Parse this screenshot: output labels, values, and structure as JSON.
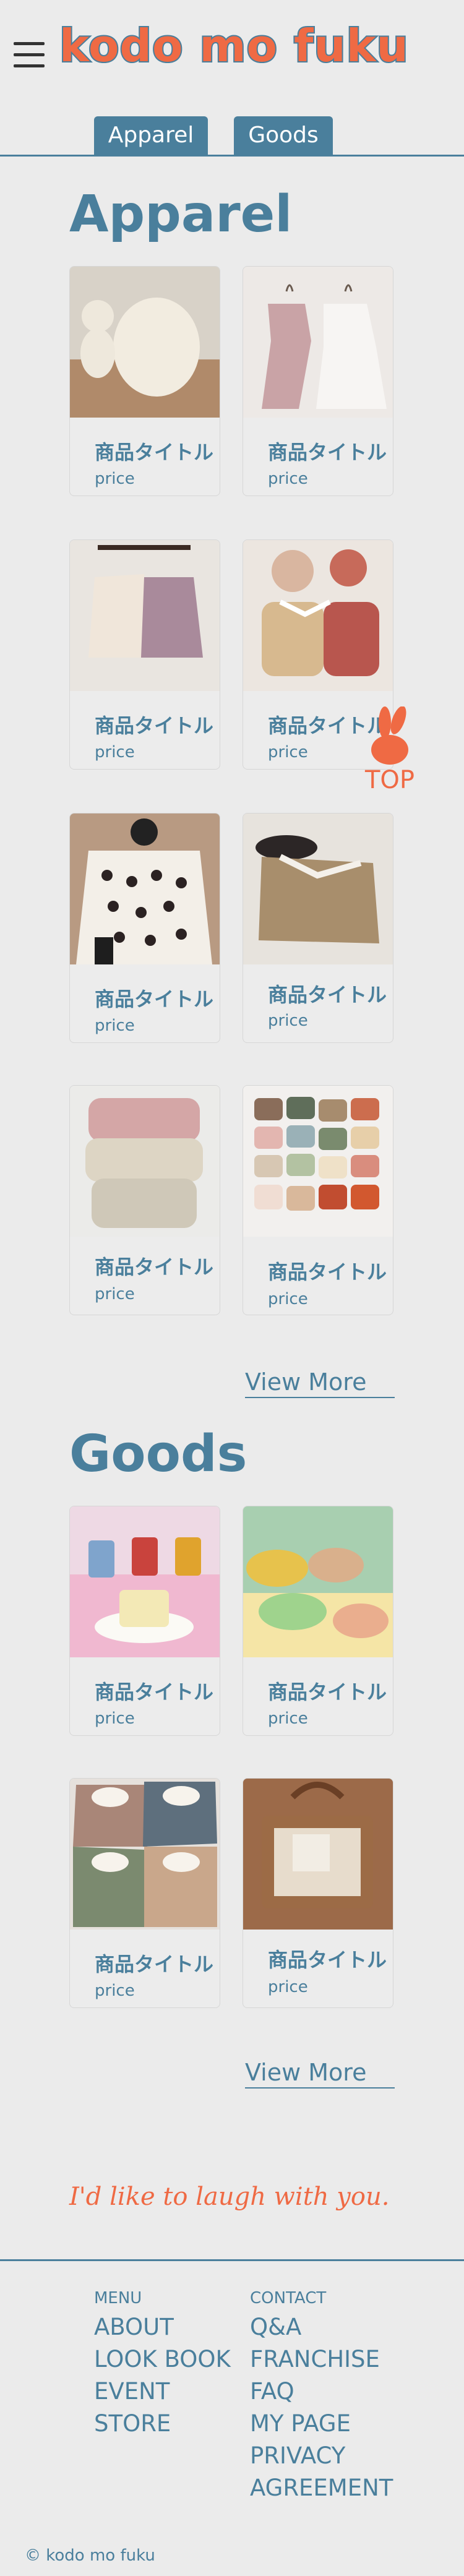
{
  "header": {
    "logo": "kodo mo fuku",
    "tabs": [
      "Apparel",
      "Goods"
    ]
  },
  "apparel": {
    "title": "Apparel",
    "items": [
      {
        "title": "商品タイトル",
        "price": "price"
      },
      {
        "title": "商品タイトル",
        "price": "price"
      },
      {
        "title": "商品タイトル",
        "price": "price"
      },
      {
        "title": "商品タイトル",
        "price": "price"
      },
      {
        "title": "商品タイトル",
        "price": "price"
      },
      {
        "title": "商品タイトル",
        "price": "price"
      },
      {
        "title": "商品タイトル",
        "price": "price"
      },
      {
        "title": "商品タイトル",
        "price": "price"
      }
    ],
    "view_more": "View More"
  },
  "goods": {
    "title": "Goods",
    "items": [
      {
        "title": "商品タイトル",
        "price": "price"
      },
      {
        "title": "商品タイトル",
        "price": "price"
      },
      {
        "title": "商品タイトル",
        "price": "price"
      },
      {
        "title": "商品タイトル",
        "price": "price"
      }
    ],
    "view_more": "View More"
  },
  "top_button": {
    "label": "TOP",
    "icon": "rabbit-icon"
  },
  "slogan": "I'd like to laugh with you.",
  "footer": {
    "menu_heading": "MENU",
    "menu_links": [
      "ABOUT",
      "LOOK BOOK",
      "EVENT",
      "STORE"
    ],
    "contact_heading": "CONTACT",
    "contact_links": [
      "Q&A",
      "FRANCHISE",
      "FAQ",
      "MY PAGE",
      "PRIVACY",
      "AGREEMENT"
    ],
    "copyright": "© kodo mo fuku"
  },
  "colors": {
    "accent": "#4a7f9c",
    "brand_orange": "#ef6a44",
    "background": "#ebebeb"
  }
}
